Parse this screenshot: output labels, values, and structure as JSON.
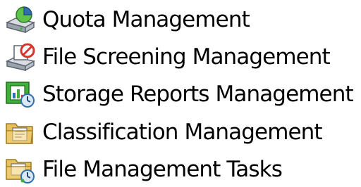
{
  "tree": {
    "items": [
      {
        "label": "Quota Management",
        "icon": "quota-management-icon"
      },
      {
        "label": "File Screening Management",
        "icon": "file-screening-icon"
      },
      {
        "label": "Storage Reports Management",
        "icon": "storage-reports-icon"
      },
      {
        "label": "Classification Management",
        "icon": "classification-folder-icon"
      },
      {
        "label": "File Management Tasks",
        "icon": "file-tasks-folder-icon"
      }
    ]
  },
  "colors": {
    "background": "#ffffff",
    "text": "#000000",
    "folder_yellow": "#e8c15a",
    "green_accent": "#3fae3a",
    "blue_accent": "#2f6fb0",
    "red_accent": "#d9342b"
  }
}
